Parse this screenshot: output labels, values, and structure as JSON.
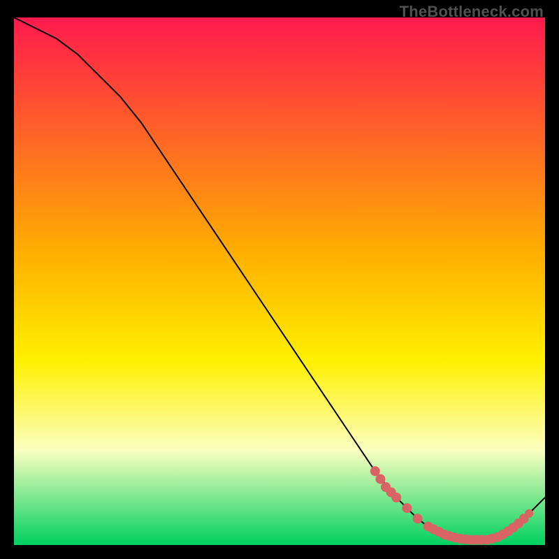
{
  "watermark": "TheBottleneck.com",
  "colors": {
    "background": "#000000",
    "grad_top": "#ff1a4d",
    "grad_mid1": "#ffb000",
    "grad_mid2": "#fff000",
    "grad_mid3": "#fbffc0",
    "grad_bottom": "#00d060",
    "curve": "#000000",
    "dots": "#d86464"
  },
  "chart_data": {
    "type": "line",
    "title": "",
    "xlabel": "",
    "ylabel": "",
    "xlim": [
      0,
      100
    ],
    "ylim": [
      0,
      100
    ],
    "curve": {
      "x": [
        0,
        4,
        8,
        12,
        16,
        20,
        24,
        28,
        32,
        36,
        40,
        44,
        48,
        52,
        56,
        60,
        64,
        68,
        72,
        76,
        80,
        84,
        88,
        92,
        96,
        100
      ],
      "y": [
        100,
        98,
        96,
        93,
        89,
        85,
        80,
        74,
        68,
        62,
        56,
        50,
        44,
        38,
        32,
        26,
        20,
        14,
        9,
        5,
        2,
        1,
        1,
        2,
        5,
        9
      ]
    },
    "dots_main": {
      "x": [
        68,
        69,
        70,
        71,
        72,
        74,
        76,
        78,
        79,
        80,
        81,
        82,
        83,
        84,
        85,
        86,
        87,
        88,
        89,
        90,
        91,
        92,
        93,
        94,
        95,
        96
      ],
      "y": [
        14,
        12.5,
        11,
        10,
        9,
        7,
        5,
        3.5,
        3,
        2.5,
        2,
        1.7,
        1.4,
        1.2,
        1.1,
        1,
        1,
        1,
        1,
        1.2,
        1.5,
        2,
        2.6,
        3.3,
        4.1,
        5
      ]
    },
    "dots_right": {
      "x": [
        93,
        94,
        95,
        96,
        97
      ],
      "y": [
        2.6,
        3.3,
        4.1,
        5,
        6
      ]
    }
  }
}
